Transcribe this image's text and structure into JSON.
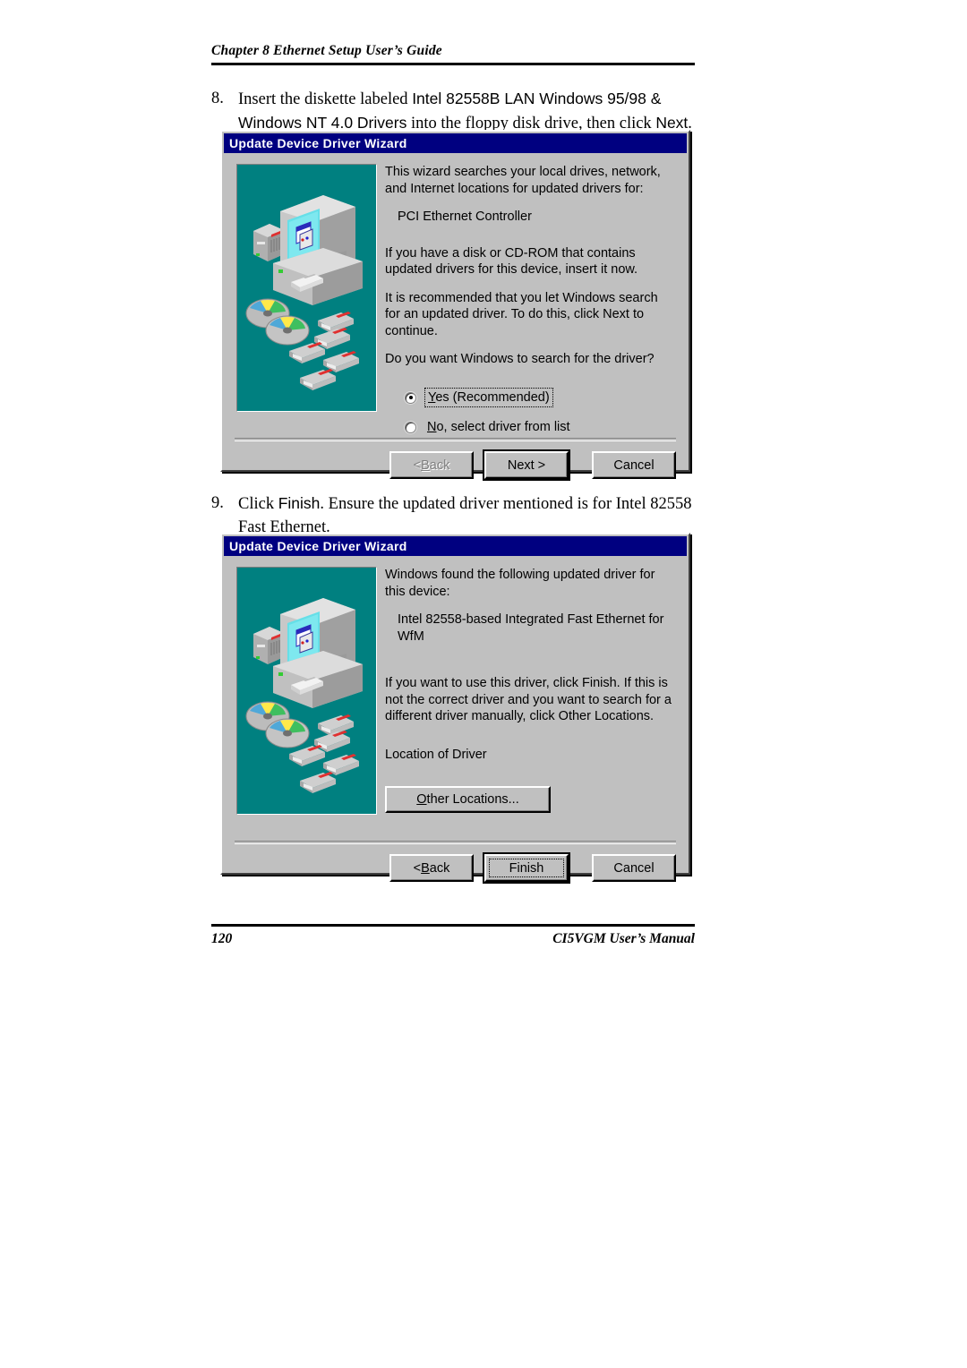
{
  "page": {
    "header": "Chapter 8  Ethernet Setup User’s Guide",
    "footer_page_number": "120",
    "footer_manual": "CI5VGM User’s Manual"
  },
  "steps": [
    {
      "number": "8.",
      "text_part1": "Insert the diskette labeled ",
      "emphasis1": "Intel 82558B LAN Windows 95/98 & Windows NT 4.0 Drivers",
      "text_part2": " into the floppy disk drive, then click ",
      "emphasis2": "Next",
      "text_part3": "."
    },
    {
      "number": "9.",
      "text_part1": "Click ",
      "emphasis1": "Finish",
      "text_part2": ". Ensure the updated driver mentioned is for Intel 82558 Fast Ethernet."
    }
  ],
  "dialog1": {
    "title": "Update Device Driver Wizard",
    "paragraphs": [
      "This wizard searches your local drives, network, and Internet locations for updated drivers for:",
      "PCI Ethernet Controller",
      "If you have a disk or CD-ROM that contains updated drivers for this device, insert it now.",
      "It is recommended that you let Windows search for an updated driver. To do this, click Next to continue.",
      "Do you want Windows to search for the driver?"
    ],
    "radios": [
      {
        "label_accel": "Y",
        "label_rest": "es (Recommended)",
        "selected": true,
        "focused": true
      },
      {
        "label_accel": "N",
        "label_rest": "o, select driver from list",
        "selected": false,
        "focused": false
      }
    ],
    "buttons": [
      {
        "name": "back",
        "label_pre": "< ",
        "label_accel": "B",
        "label_rest": "ack",
        "state": "disabled"
      },
      {
        "name": "next",
        "label_pre": "",
        "label_accel": "",
        "label_rest": "Next >",
        "state": "default"
      },
      {
        "name": "cancel",
        "label_pre": "",
        "label_accel": "",
        "label_rest": "Cancel",
        "state": "normal"
      }
    ],
    "illustration": {
      "background_color": "#008080",
      "items": [
        "computer-monitor",
        "tower-case",
        "floppy-drive",
        "cd-discs",
        "floppy-disks"
      ]
    }
  },
  "dialog2": {
    "title": "Update Device Driver Wizard",
    "paragraphs": [
      "Windows found the following updated driver for this device:",
      "Intel 82558-based Integrated Fast Ethernet for WfM",
      "If you want to use this driver, click Finish. If this is not the correct driver and you want to search for a different driver manually, click Other Locations.",
      "Location of Driver"
    ],
    "other_locations_button": {
      "label_accel": "O",
      "label_rest": "ther Locations..."
    },
    "buttons": [
      {
        "name": "back",
        "label_pre": "< ",
        "label_accel": "B",
        "label_rest": "ack",
        "state": "normal"
      },
      {
        "name": "finish",
        "label_pre": "",
        "label_accel": "",
        "label_rest": "Finish",
        "state": "default-focused"
      },
      {
        "name": "cancel",
        "label_pre": "",
        "label_accel": "",
        "label_rest": "Cancel",
        "state": "normal"
      }
    ],
    "illustration": {
      "background_color": "#008080",
      "items": [
        "computer-monitor",
        "tower-case",
        "floppy-drive",
        "cd-discs",
        "floppy-disks"
      ]
    }
  },
  "colors": {
    "titlebar": "#000080",
    "dialog_face": "#c0c0c0",
    "illustration_teal": "#008080"
  }
}
